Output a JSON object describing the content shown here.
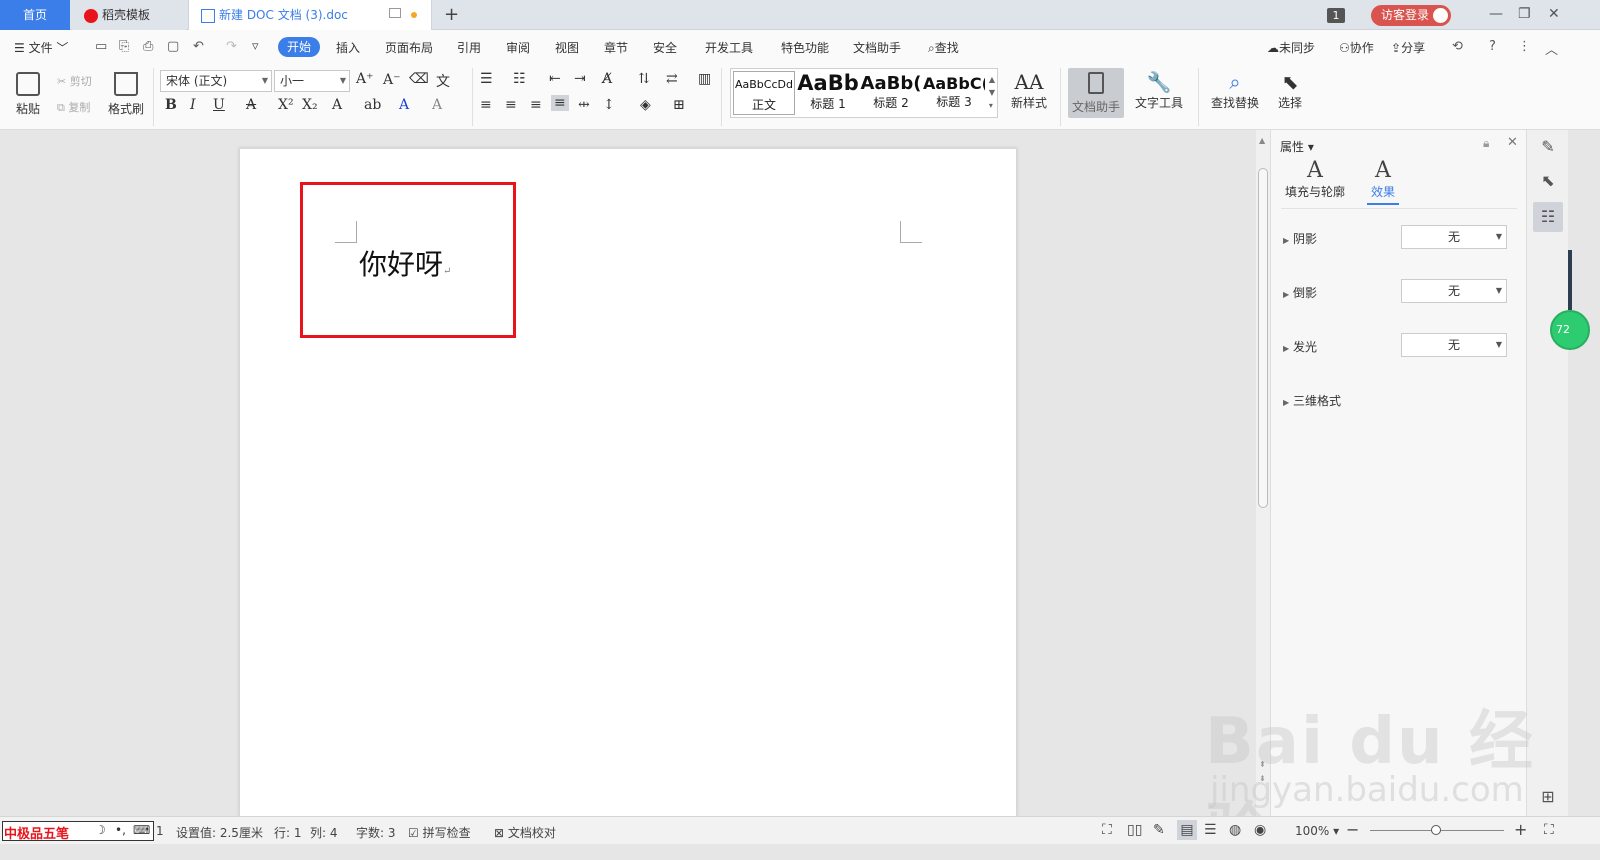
{
  "tabs": [
    {
      "label": "首页"
    },
    {
      "label": "稻壳模板"
    },
    {
      "label": "新建 DOC 文档 (3).doc"
    }
  ],
  "title_right": {
    "window_count": "1",
    "login": "访客登录"
  },
  "menu": {
    "file": "文件",
    "items": [
      "开始",
      "插入",
      "页面布局",
      "引用",
      "审阅",
      "视图",
      "章节",
      "安全",
      "开发工具",
      "特色功能",
      "文档助手"
    ],
    "search": "查找",
    "right": [
      "未同步",
      "协作",
      "分享"
    ]
  },
  "ribbon": {
    "paste": "粘贴",
    "cut": "剪切",
    "copy": "复制",
    "format_painter": "格式刷",
    "font_name": "宋体 (正文)",
    "font_size": "小一",
    "styles": [
      {
        "sample": "AaBbCcDd",
        "name": "正文"
      },
      {
        "sample": "AaBb",
        "name": "标题 1"
      },
      {
        "sample": "AaBb(",
        "name": "标题 2"
      },
      {
        "sample": "AaBbC(",
        "name": "标题 3"
      }
    ],
    "new_style": "新样式",
    "doc_assistant": "文档助手",
    "text_tools": "文字工具",
    "find_replace": "查找替换",
    "select": "选择"
  },
  "document": {
    "text": "你好呀",
    "para_mark": "↵"
  },
  "properties": {
    "title": "属性",
    "tabs": [
      {
        "glyph": "A",
        "label": "填充与轮廓"
      },
      {
        "glyph": "A",
        "label": "效果"
      }
    ],
    "rows": [
      {
        "label": "阴影",
        "value": "无"
      },
      {
        "label": "倒影",
        "value": "无"
      },
      {
        "label": "发光",
        "value": "无"
      },
      {
        "label": "三维格式"
      }
    ]
  },
  "statusbar": {
    "ime": "中极品五笔",
    "ime_extra": "1",
    "setting": "设置值: 2.5厘米",
    "row": "行: 1",
    "col": "列: 4",
    "words": "字数: 3",
    "spell": "拼写检查",
    "proof": "文档校对",
    "zoom": "100%"
  },
  "floating": {
    "green_badge": "72"
  },
  "watermark": {
    "main": "Bai du 经验",
    "sub": "jingyan.baidu.com"
  }
}
